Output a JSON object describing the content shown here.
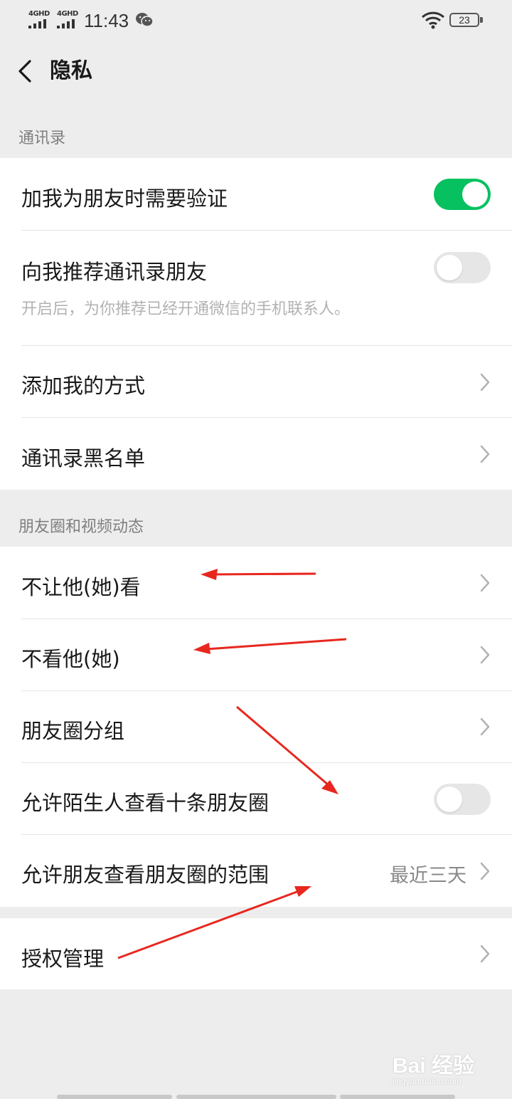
{
  "status_bar": {
    "network_1": "4GHD",
    "network_2": "4GHD",
    "time": "11:43",
    "battery": "23"
  },
  "nav": {
    "title": "隐私",
    "back_icon": "chevron-left-icon"
  },
  "sections": [
    {
      "title": "通讯录",
      "items": [
        {
          "label": "加我为朋友时需要验证",
          "control": "toggle",
          "on": true
        },
        {
          "label": "向我推荐通讯录朋友",
          "control": "toggle",
          "on": false,
          "description": "开启后，为你推荐已经开通微信的手机联系人。"
        },
        {
          "label": "添加我的方式",
          "control": "chevron"
        },
        {
          "label": "通讯录黑名单",
          "control": "chevron"
        }
      ]
    },
    {
      "title": "朋友圈和视频动态",
      "items": [
        {
          "label": "不让他(她)看",
          "control": "chevron"
        },
        {
          "label": "不看他(她)",
          "control": "chevron"
        },
        {
          "label": "朋友圈分组",
          "control": "chevron"
        },
        {
          "label": "允许陌生人查看十条朋友圈",
          "control": "toggle",
          "on": false
        },
        {
          "label": "允许朋友查看朋友圈的范围",
          "control": "chevron",
          "value": "最近三天"
        }
      ]
    },
    {
      "title": "",
      "items": [
        {
          "label": "授权管理",
          "control": "chevron"
        }
      ]
    }
  ],
  "watermark": {
    "text": "Bai 经验",
    "sub": "jingyan.baidu.com"
  },
  "colors": {
    "toggle_on": "#07c160",
    "toggle_off": "#e6e6e6",
    "background": "#ededed",
    "annotation_arrow": "#e8271f"
  }
}
